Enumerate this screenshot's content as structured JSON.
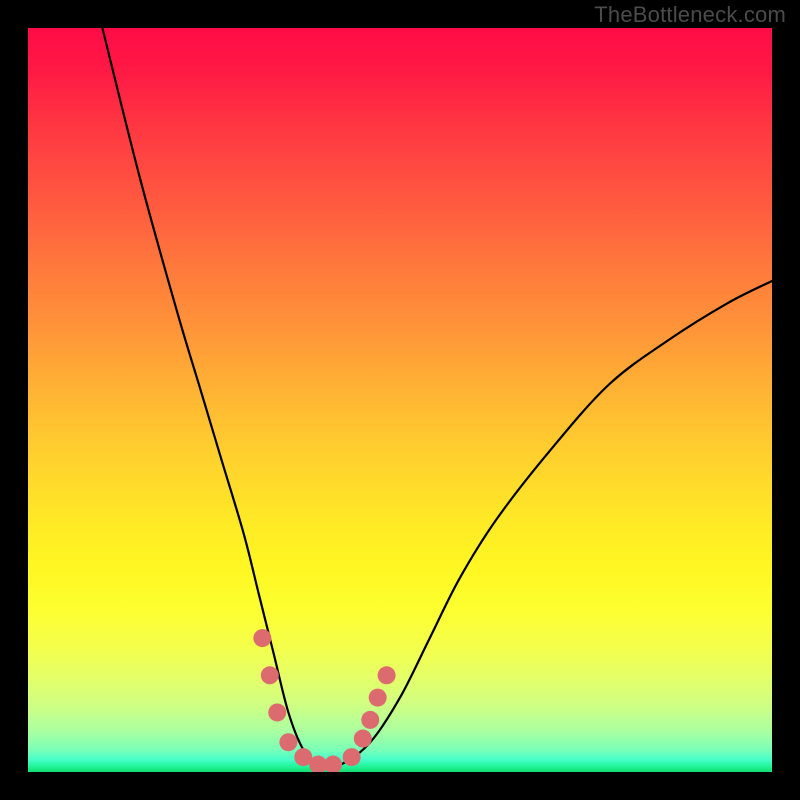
{
  "watermark": "TheBottleneck.com",
  "chart_data": {
    "type": "line",
    "title": "",
    "xlabel": "",
    "ylabel": "",
    "xlim": [
      0,
      100
    ],
    "ylim": [
      0,
      100
    ],
    "series": [
      {
        "name": "bottleneck-curve",
        "x": [
          10,
          15,
          20,
          23,
          26,
          29,
          31,
          33,
          35,
          37,
          39,
          42,
          46,
          50,
          54,
          58,
          63,
          70,
          78,
          86,
          94,
          100
        ],
        "y": [
          100,
          80,
          62,
          52,
          42,
          32,
          24,
          16,
          8,
          3,
          1,
          1,
          4,
          10,
          18,
          26,
          34,
          43,
          52,
          58,
          63,
          66
        ]
      }
    ],
    "markers": {
      "name": "highlight-dots",
      "color": "#dc6b6f",
      "points": [
        {
          "x": 31.5,
          "y": 18
        },
        {
          "x": 32.5,
          "y": 13
        },
        {
          "x": 33.5,
          "y": 8
        },
        {
          "x": 35.0,
          "y": 4
        },
        {
          "x": 37.0,
          "y": 2
        },
        {
          "x": 39.0,
          "y": 1
        },
        {
          "x": 41.0,
          "y": 1
        },
        {
          "x": 43.5,
          "y": 2
        },
        {
          "x": 45.0,
          "y": 4.5
        },
        {
          "x": 46.0,
          "y": 7
        },
        {
          "x": 47.0,
          "y": 10
        },
        {
          "x": 48.2,
          "y": 13
        }
      ]
    }
  }
}
